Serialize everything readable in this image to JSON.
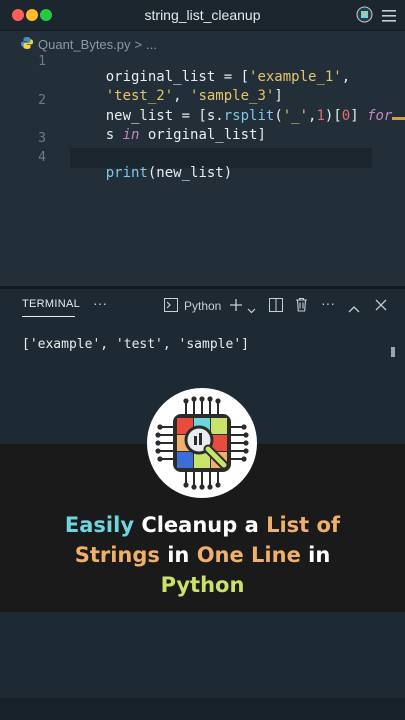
{
  "window": {
    "title": "string_list_cleanup",
    "traffic_lights": [
      "#ff5f57",
      "#febc2e",
      "#28c840"
    ]
  },
  "breadcrumb": {
    "file": "Quant_Bytes.py",
    "separator": ">",
    "rest": "..."
  },
  "editor": {
    "line_numbers": [
      "1",
      "2",
      "3",
      "4"
    ],
    "lines": [
      {
        "num_ref": 0,
        "parts": [
          [
            "original_list = [",
            "t"
          ],
          [
            "'example_1'",
            "s"
          ],
          [
            ",",
            "t"
          ]
        ]
      },
      {
        "num_ref": -1,
        "parts": [
          [
            "'test_2'",
            "s"
          ],
          [
            ", ",
            "t"
          ],
          [
            "'sample_3'",
            "s"
          ],
          [
            "]",
            "t"
          ]
        ]
      },
      {
        "num_ref": 1,
        "parts": [
          [
            "new_list = [s.",
            "t"
          ],
          [
            "rsplit",
            "f"
          ],
          [
            "(",
            "t"
          ],
          [
            "'_'",
            "s"
          ],
          [
            ",",
            "t"
          ],
          [
            "1",
            "n"
          ],
          [
            ")[",
            "t"
          ],
          [
            "0",
            "n"
          ],
          [
            "] ",
            "t"
          ],
          [
            "for",
            "kw"
          ]
        ]
      },
      {
        "num_ref": -1,
        "parts": [
          [
            "s ",
            "t"
          ],
          [
            "in",
            "kw"
          ],
          [
            " original_list]",
            "t"
          ]
        ]
      },
      {
        "num_ref": 2,
        "parts": []
      },
      {
        "num_ref": 3,
        "parts": [
          [
            "print",
            "f"
          ],
          [
            "(new_list)",
            "t"
          ]
        ]
      }
    ]
  },
  "panel": {
    "tab_label": "TERMINAL",
    "more_label": "···",
    "shell_label": "Python",
    "terminal_output": "['example', 'test', 'sample']"
  },
  "banner": {
    "line1": [
      [
        "Easily",
        "c1"
      ],
      [
        " Cleanup a ",
        "w"
      ],
      [
        "List of",
        "c2"
      ]
    ],
    "line2": [
      [
        "Strings",
        "c2"
      ],
      [
        " in ",
        "w"
      ],
      [
        "One Line",
        "c2"
      ],
      [
        " in",
        "w"
      ]
    ],
    "line3": [
      [
        "Python",
        "c3"
      ]
    ]
  },
  "colors": {
    "accent_yellow": "#c9a24a",
    "cyan": "#6dd5de",
    "orange": "#f0b06b",
    "lime": "#c9e36a"
  },
  "icons": [
    "python-file-icon",
    "extension-icon",
    "menu-icon",
    "terminal-icon",
    "add-icon",
    "chevron-down-icon",
    "split-icon",
    "trash-icon",
    "more-icon",
    "chevron-up-icon",
    "close-icon",
    "logo-icon"
  ]
}
